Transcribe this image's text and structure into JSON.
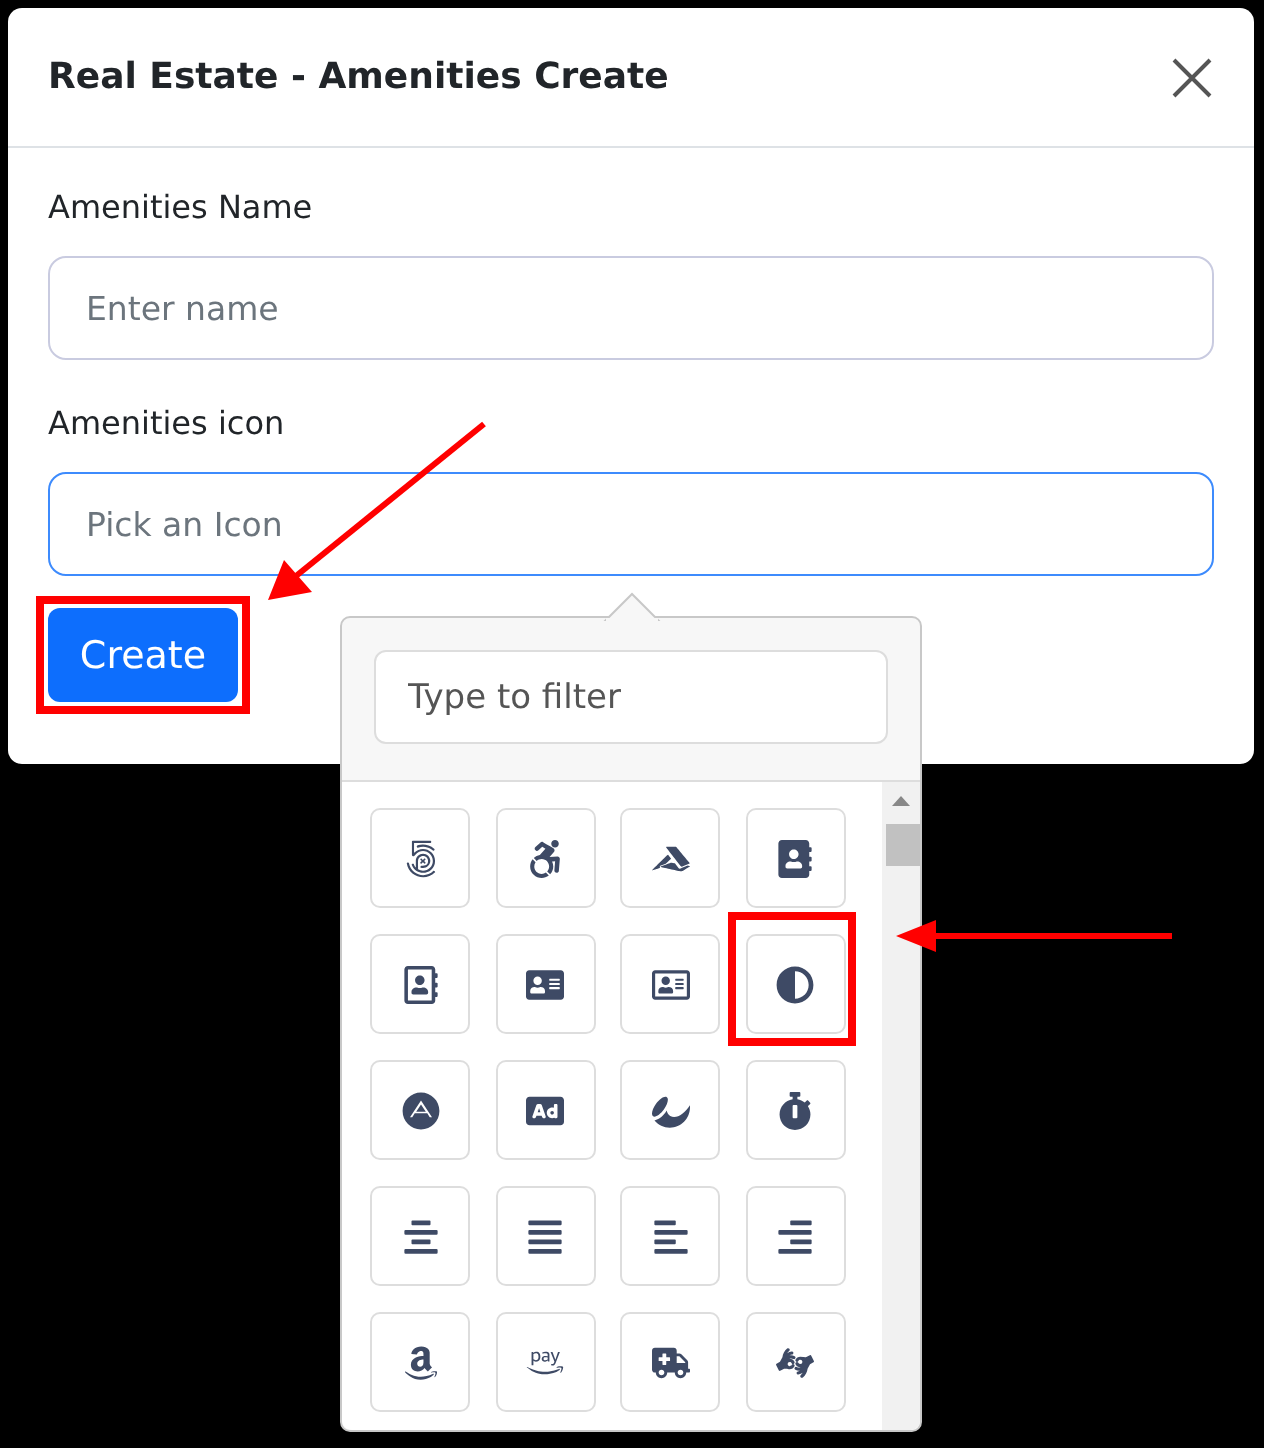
{
  "dialog": {
    "title": "Real Estate - Amenities Create"
  },
  "fields": [
    {
      "label": "Amenities Name",
      "placeholder": "Enter name",
      "focused": false
    },
    {
      "label": "Amenities icon",
      "placeholder": "Pick an Icon",
      "focused": true
    }
  ],
  "create_button": {
    "label": "Create",
    "highlighted": true
  },
  "icon_picker": {
    "filter": {
      "placeholder": "Type to filter"
    },
    "icons": [
      {
        "kind": "fivehundred",
        "highlighted": false
      },
      {
        "kind": "accessible",
        "highlighted": false
      },
      {
        "kind": "accusoft",
        "highlighted": false
      },
      {
        "kind": "address-book",
        "highlighted": false
      },
      {
        "kind": "address-book-outline",
        "highlighted": false
      },
      {
        "kind": "address-card",
        "highlighted": false
      },
      {
        "kind": "address-card-outline",
        "highlighted": false
      },
      {
        "kind": "adjust",
        "highlighted": true
      },
      {
        "kind": "adn",
        "highlighted": false
      },
      {
        "kind": "ad",
        "highlighted": false
      },
      {
        "kind": "affiliatetheme",
        "highlighted": false
      },
      {
        "kind": "stopwatch",
        "highlighted": false
      },
      {
        "kind": "align-center",
        "highlighted": false
      },
      {
        "kind": "align-justify",
        "highlighted": false
      },
      {
        "kind": "align-left",
        "highlighted": false
      },
      {
        "kind": "align-right",
        "highlighted": false
      },
      {
        "kind": "amazon",
        "highlighted": false
      },
      {
        "kind": "amazon-pay",
        "highlighted": false
      },
      {
        "kind": "ambulance",
        "highlighted": false
      },
      {
        "kind": "sign-language",
        "highlighted": false
      }
    ]
  }
}
